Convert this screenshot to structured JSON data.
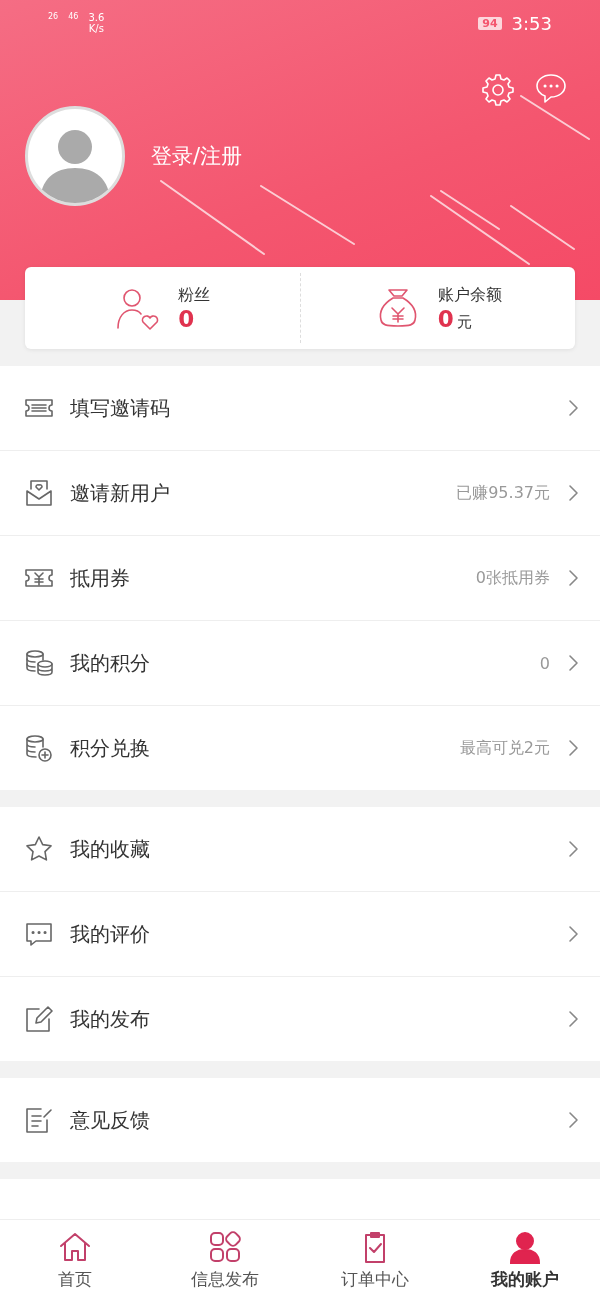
{
  "status_bar": {
    "signal_labels": [
      "26",
      "46"
    ],
    "speed": [
      "3.6",
      "K/s"
    ],
    "battery": "94",
    "time": "3:53"
  },
  "profile": {
    "login": "登录/注册"
  },
  "stats": [
    {
      "kind": "fans",
      "label": "粉丝",
      "value": "0"
    },
    {
      "kind": "balance",
      "label": "账户余额",
      "value": "0",
      "unit": "元"
    }
  ],
  "menu_groups": [
    [
      {
        "kind": "ticket",
        "label": "填写邀请码"
      },
      {
        "kind": "mail",
        "label": "邀请新用户",
        "detail": "已赚95.37元"
      },
      {
        "kind": "coupon",
        "label": "抵用券",
        "detail": "0张抵用券"
      },
      {
        "kind": "coins",
        "label": "我的积分",
        "detail": "0"
      },
      {
        "kind": "exchange",
        "label": "积分兑换",
        "detail": "最高可兑2元"
      }
    ],
    [
      {
        "kind": "star",
        "label": "我的收藏"
      },
      {
        "kind": "comment",
        "label": "我的评价"
      },
      {
        "kind": "edit",
        "label": "我的发布"
      }
    ],
    [
      {
        "kind": "feedback",
        "label": "意见反馈"
      }
    ]
  ],
  "tabs": [
    {
      "kind": "home",
      "label": "首页",
      "selected": false
    },
    {
      "kind": "grid",
      "label": "信息发布",
      "selected": false
    },
    {
      "kind": "order",
      "label": "订单中心",
      "selected": false
    },
    {
      "kind": "account",
      "label": "我的账户",
      "selected": true
    }
  ]
}
